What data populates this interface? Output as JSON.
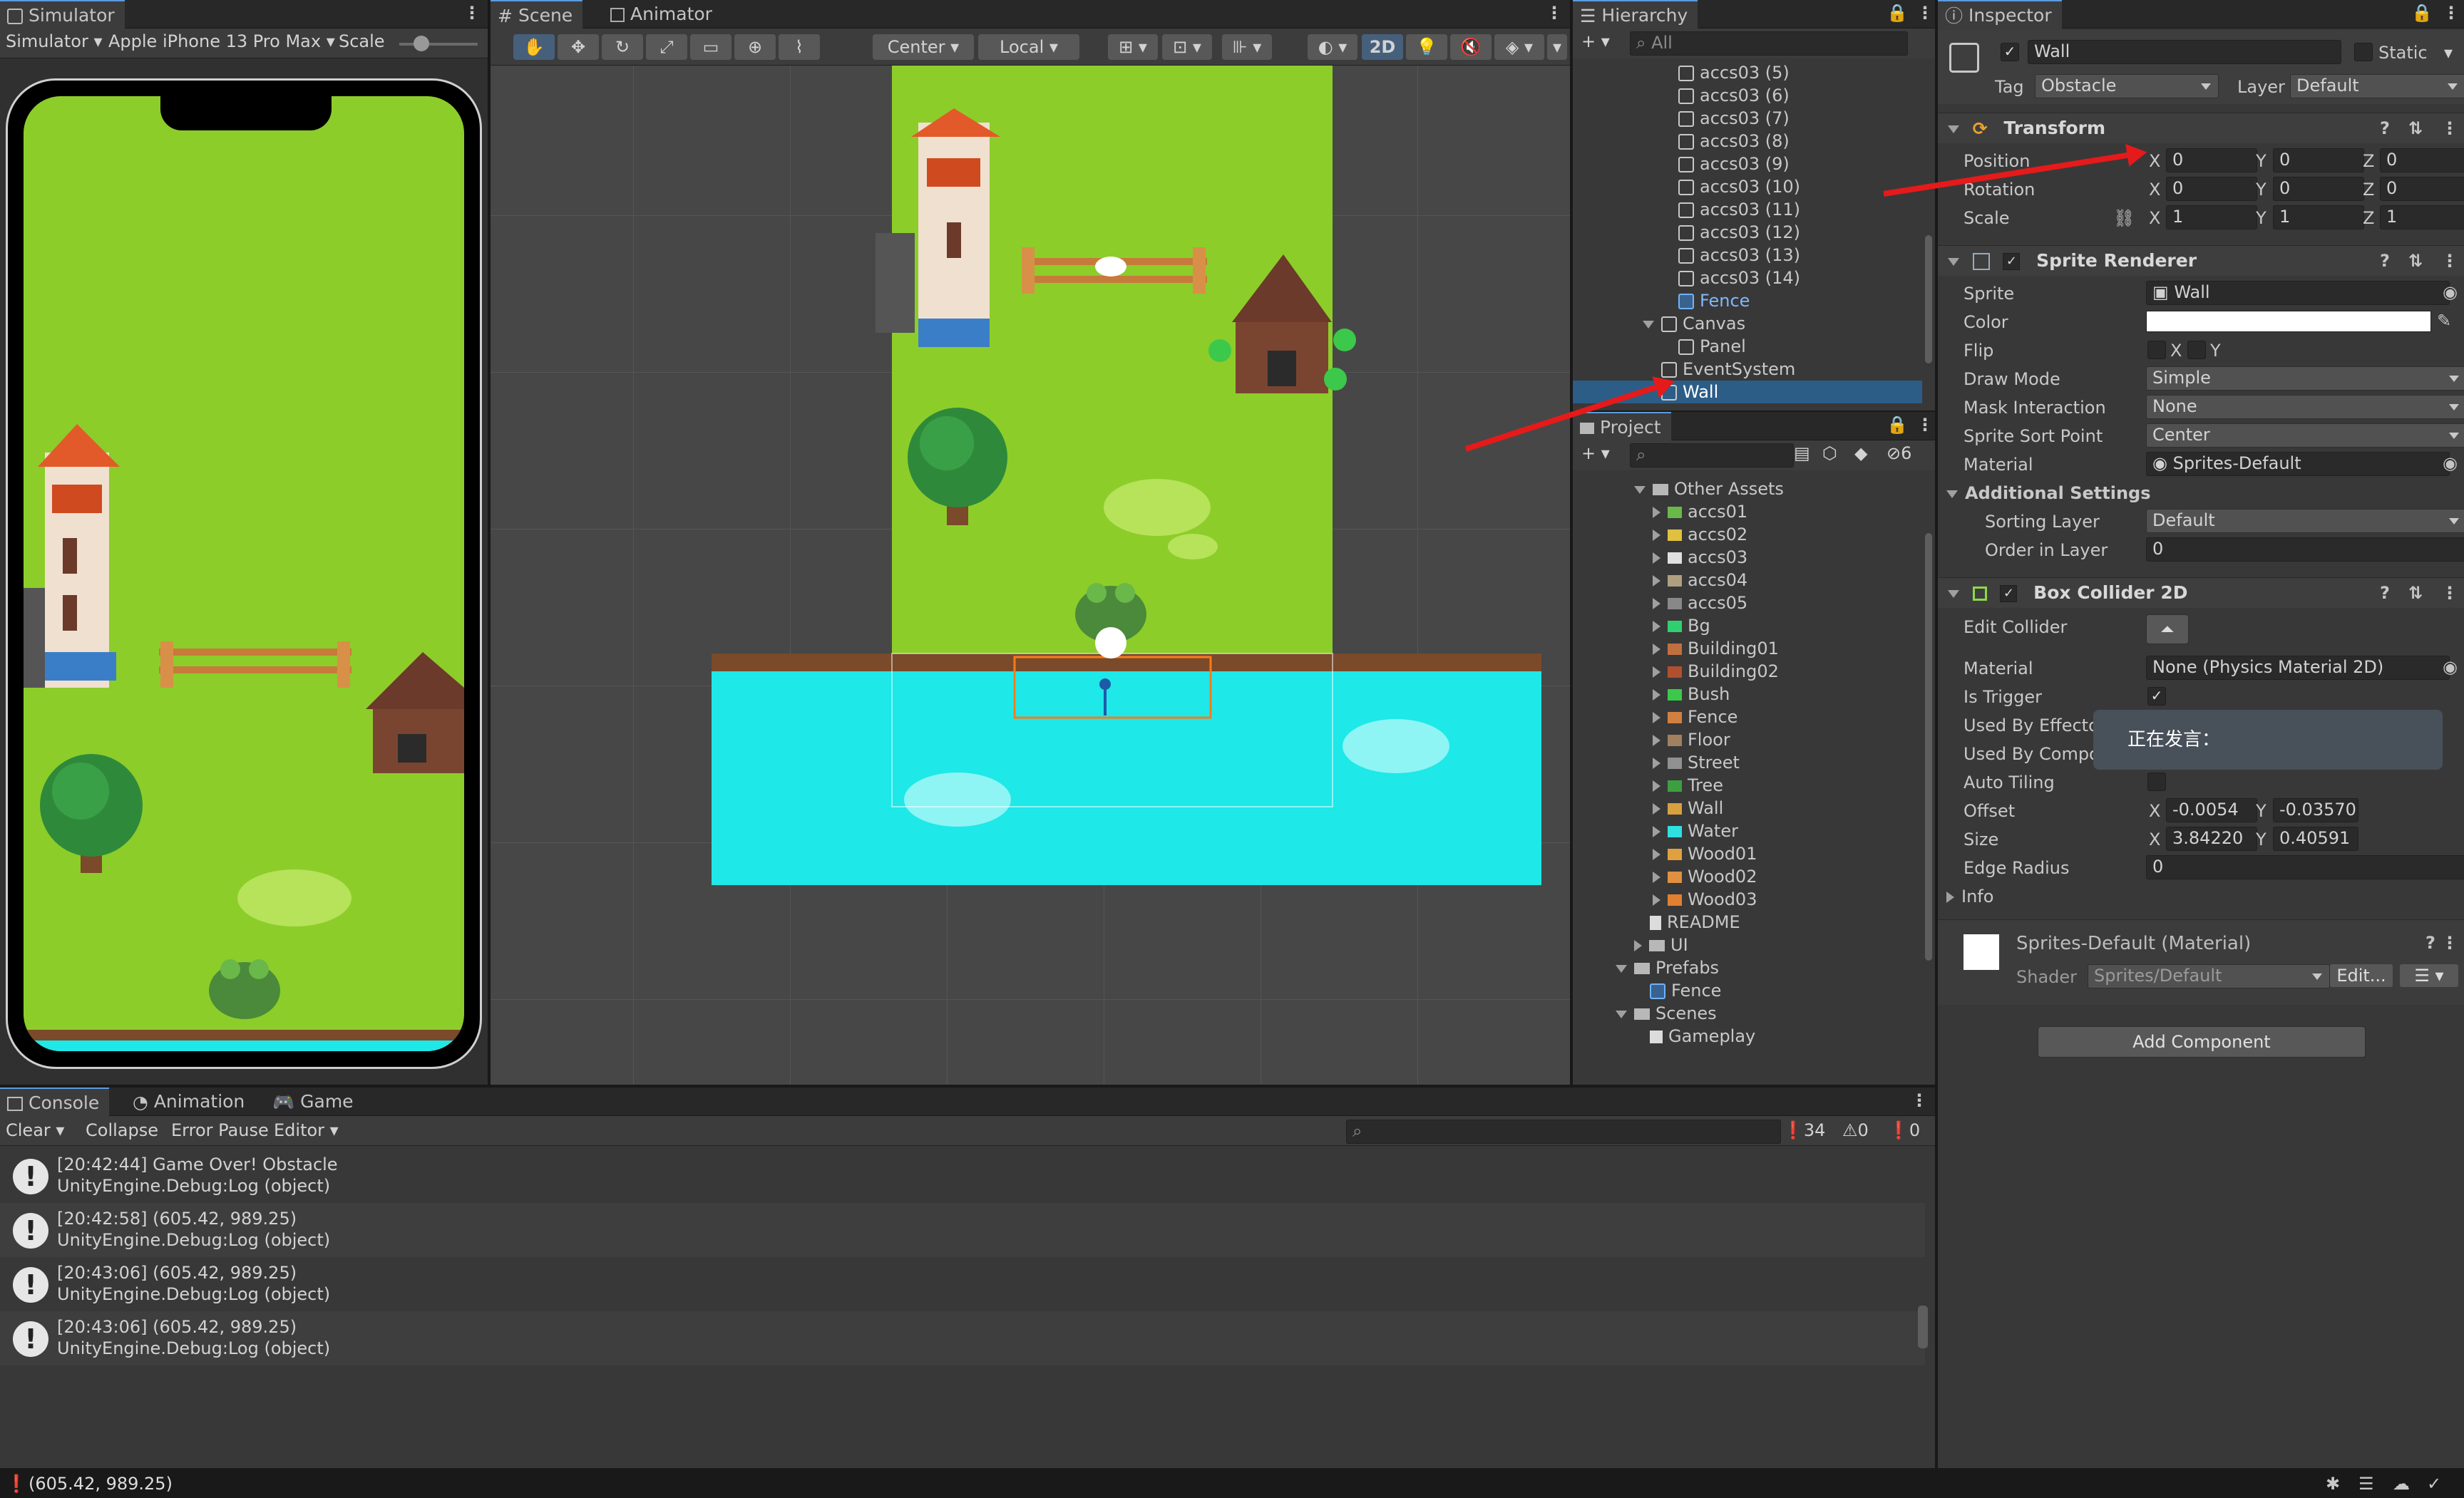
{
  "simulator": {
    "tab": "Simulator",
    "mode": "Simulator",
    "device": "Apple iPhone 13 Pro Max",
    "scale_label": "Scale"
  },
  "scene": {
    "tabs": [
      "Scene",
      "Animator"
    ],
    "pivot": "Center",
    "space": "Local",
    "mode_2d": "2D"
  },
  "hierarchy": {
    "tab": "Hierarchy",
    "search_placeholder": "All",
    "items": [
      {
        "label": "accs03 (5)",
        "indent": 1,
        "type": "obj"
      },
      {
        "label": "accs03 (6)",
        "indent": 1,
        "type": "obj"
      },
      {
        "label": "accs03 (7)",
        "indent": 1,
        "type": "obj"
      },
      {
        "label": "accs03 (8)",
        "indent": 1,
        "type": "obj"
      },
      {
        "label": "accs03 (9)",
        "indent": 1,
        "type": "obj"
      },
      {
        "label": "accs03 (10)",
        "indent": 1,
        "type": "obj"
      },
      {
        "label": "accs03 (11)",
        "indent": 1,
        "type": "obj"
      },
      {
        "label": "accs03 (12)",
        "indent": 1,
        "type": "obj"
      },
      {
        "label": "accs03 (13)",
        "indent": 1,
        "type": "obj"
      },
      {
        "label": "accs03 (14)",
        "indent": 1,
        "type": "obj"
      },
      {
        "label": "Fence",
        "indent": 1,
        "type": "prefab"
      },
      {
        "label": "Canvas",
        "indent": 0,
        "type": "obj"
      },
      {
        "label": "Panel",
        "indent": 1,
        "type": "obj"
      },
      {
        "label": "EventSystem",
        "indent": 0,
        "type": "obj"
      },
      {
        "label": "Wall",
        "indent": 0,
        "type": "selected"
      }
    ]
  },
  "project": {
    "tab": "Project",
    "hidden_count": "6",
    "items": [
      {
        "label": "Other Assets",
        "level": 0,
        "kind": "folder-open"
      },
      {
        "label": "accs01",
        "level": 1,
        "kind": "asset"
      },
      {
        "label": "accs02",
        "level": 1,
        "kind": "asset"
      },
      {
        "label": "accs03",
        "level": 1,
        "kind": "asset"
      },
      {
        "label": "accs04",
        "level": 1,
        "kind": "asset"
      },
      {
        "label": "accs05",
        "level": 1,
        "kind": "asset"
      },
      {
        "label": "Bg",
        "level": 1,
        "kind": "asset"
      },
      {
        "label": "Building01",
        "level": 1,
        "kind": "asset"
      },
      {
        "label": "Building02",
        "level": 1,
        "kind": "asset"
      },
      {
        "label": "Bush",
        "level": 1,
        "kind": "asset"
      },
      {
        "label": "Fence",
        "level": 1,
        "kind": "asset"
      },
      {
        "label": "Floor",
        "level": 1,
        "kind": "asset"
      },
      {
        "label": "Street",
        "level": 1,
        "kind": "asset"
      },
      {
        "label": "Tree",
        "level": 1,
        "kind": "asset"
      },
      {
        "label": "Wall",
        "level": 1,
        "kind": "asset"
      },
      {
        "label": "Water",
        "level": 1,
        "kind": "asset"
      },
      {
        "label": "Wood01",
        "level": 1,
        "kind": "asset"
      },
      {
        "label": "Wood02",
        "level": 1,
        "kind": "asset"
      },
      {
        "label": "Wood03",
        "level": 1,
        "kind": "asset"
      },
      {
        "label": "README",
        "level": 0,
        "kind": "file"
      },
      {
        "label": "UI",
        "level": 0,
        "kind": "folder"
      },
      {
        "label": "Prefabs",
        "level": -1,
        "kind": "folder-open"
      },
      {
        "label": "Fence",
        "level": 0,
        "kind": "prefab"
      },
      {
        "label": "Scenes",
        "level": -1,
        "kind": "folder-open"
      },
      {
        "label": "Gameplay",
        "level": 0,
        "kind": "scene"
      }
    ]
  },
  "inspector": {
    "tab": "Inspector",
    "object_name": "Wall",
    "static_label": "Static",
    "tag_label": "Tag",
    "tag_value": "Obstacle",
    "layer_label": "Layer",
    "layer_value": "Default",
    "transform": {
      "title": "Transform",
      "position_label": "Position",
      "rotation_label": "Rotation",
      "scale_label": "Scale",
      "position": {
        "x": "0",
        "y": "0",
        "z": "0"
      },
      "rotation": {
        "x": "0",
        "y": "0",
        "z": "0"
      },
      "scale": {
        "x": "1",
        "y": "1",
        "z": "1"
      }
    },
    "sprite_renderer": {
      "title": "Sprite Renderer",
      "sprite_label": "Sprite",
      "sprite_value": "Wall",
      "color_label": "Color",
      "flip_label": "Flip",
      "flip_x": "X",
      "flip_y": "Y",
      "draw_mode_label": "Draw Mode",
      "draw_mode_value": "Simple",
      "mask_label": "Mask Interaction",
      "mask_value": "None",
      "sort_point_label": "Sprite Sort Point",
      "sort_point_value": "Center",
      "material_label": "Material",
      "material_value": "Sprites-Default",
      "additional_label": "Additional Settings",
      "sorting_layer_label": "Sorting Layer",
      "sorting_layer_value": "Default",
      "order_label": "Order in Layer",
      "order_value": "0"
    },
    "box_collider": {
      "title": "Box Collider 2D",
      "edit_label": "Edit Collider",
      "material_label": "Material",
      "material_value": "None (Physics Material 2D)",
      "trigger_label": "Is Trigger",
      "effector_label": "Used By Effector",
      "composite_label": "Used By Composite",
      "tiling_label": "Auto Tiling",
      "offset_label": "Offset",
      "offset_x": "-0.0054",
      "offset_y": "-0.03570",
      "size_label": "Size",
      "size_x": "3.84220",
      "size_y": "0.40591",
      "edge_label": "Edge Radius",
      "edge_value": "0",
      "info_label": "Info"
    },
    "material_section": {
      "title": "Sprites-Default (Material)",
      "shader_label": "Shader",
      "shader_value": "Sprites/Default",
      "edit_label": "Edit..."
    },
    "add_component": "Add Component",
    "tooltip": "正在发言："
  },
  "console": {
    "tabs": [
      "Console",
      "Animation",
      "Game"
    ],
    "clear": "Clear",
    "collapse": "Collapse",
    "error_pause": "Error Pause",
    "editor": "Editor",
    "counts": {
      "log": "34",
      "warn": "0",
      "error": "0"
    },
    "entries": [
      {
        "line1": "[20:42:44] Game Over! Obstacle",
        "line2": "UnityEngine.Debug:Log (object)"
      },
      {
        "line1": "[20:42:58] (605.42, 989.25)",
        "line2": "UnityEngine.Debug:Log (object)"
      },
      {
        "line1": "[20:43:06] (605.42, 989.25)",
        "line2": "UnityEngine.Debug:Log (object)"
      },
      {
        "line1": "[20:43:06] (605.42, 989.25)",
        "line2": "UnityEngine.Debug:Log (object)"
      }
    ]
  },
  "status_bar": {
    "text": "(605.42, 989.25)"
  },
  "colors": {
    "grass": "#8ccd2a",
    "water": "#1ee8e8",
    "selection": "#2c5d87",
    "arrow": "#e51a1a"
  }
}
